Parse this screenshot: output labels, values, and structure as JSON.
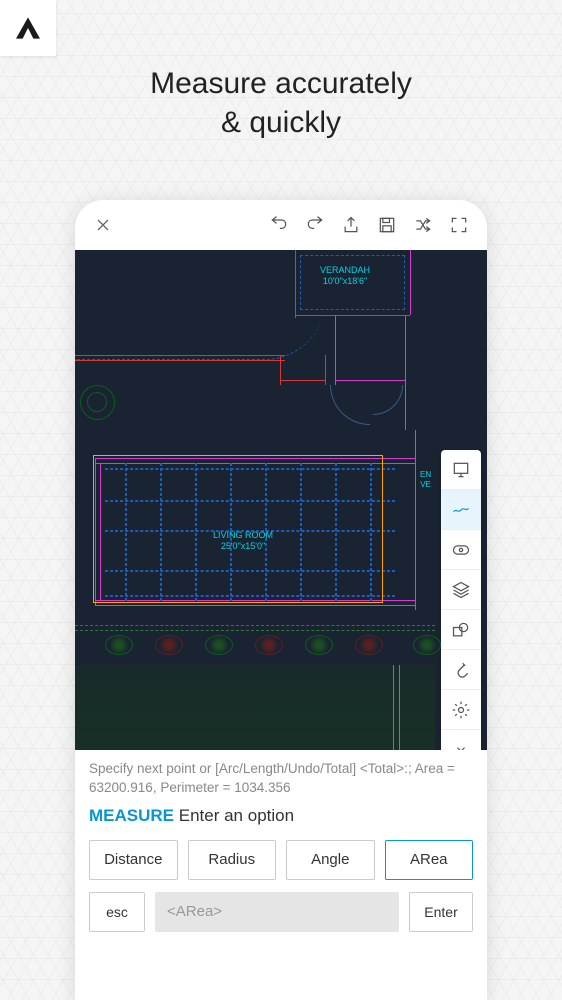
{
  "headline": {
    "line1": "Measure accurately",
    "line2": "& quickly"
  },
  "rooms": {
    "verandah": {
      "name": "VERANDAH",
      "dims": "10'0\"x18'6\""
    },
    "living": {
      "name": "LIVING ROOM",
      "dims": "25'0\"x15'0\""
    },
    "entry": {
      "name": "EN",
      "dims": "VE"
    }
  },
  "status": {
    "text": "Specify next point or [Arc/Length/Undo/Total] <Total>:; Area = 63200.916, Perimeter = 1034.356"
  },
  "command": {
    "name": "MEASURE",
    "prompt": "Enter an option"
  },
  "options": {
    "distance": "Distance",
    "radius": "Radius",
    "angle": "Angle",
    "area": "ARea"
  },
  "input": {
    "esc": "esc",
    "placeholder": "<ARea>",
    "enter": "Enter"
  }
}
